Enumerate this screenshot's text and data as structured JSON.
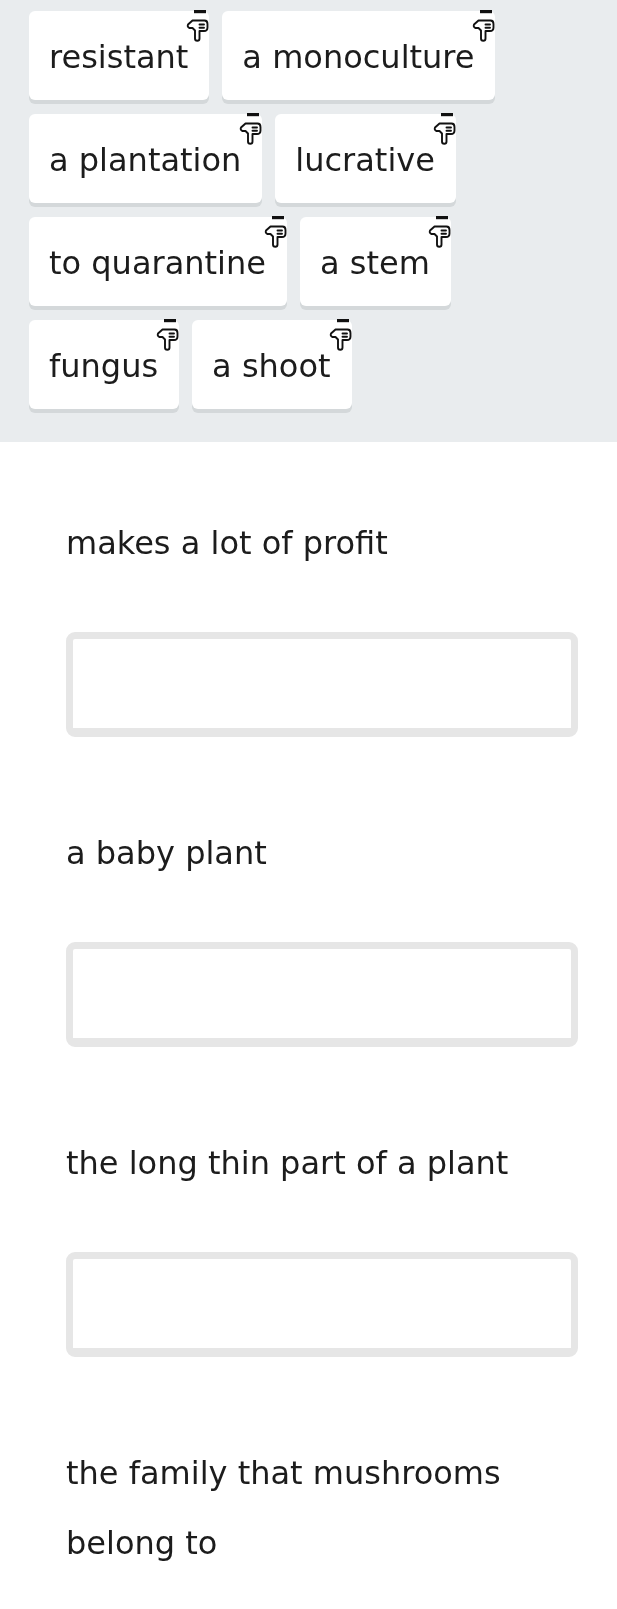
{
  "word_bank": [
    "resistant",
    "a monoculture",
    "a plantation",
    "lucrative",
    "to quarantine",
    "a stem",
    "fungus",
    "a shoot"
  ],
  "exercise": [
    {
      "kind": "prompt",
      "text": "makes a lot of profit"
    },
    {
      "kind": "answer_box"
    },
    {
      "kind": "prompt",
      "text": "a baby plant"
    },
    {
      "kind": "answer_box"
    },
    {
      "kind": "prompt",
      "text": "the long thin part of a plant"
    },
    {
      "kind": "answer_box"
    },
    {
      "kind": "prompt",
      "text": "the family that mushrooms belong to"
    }
  ]
}
